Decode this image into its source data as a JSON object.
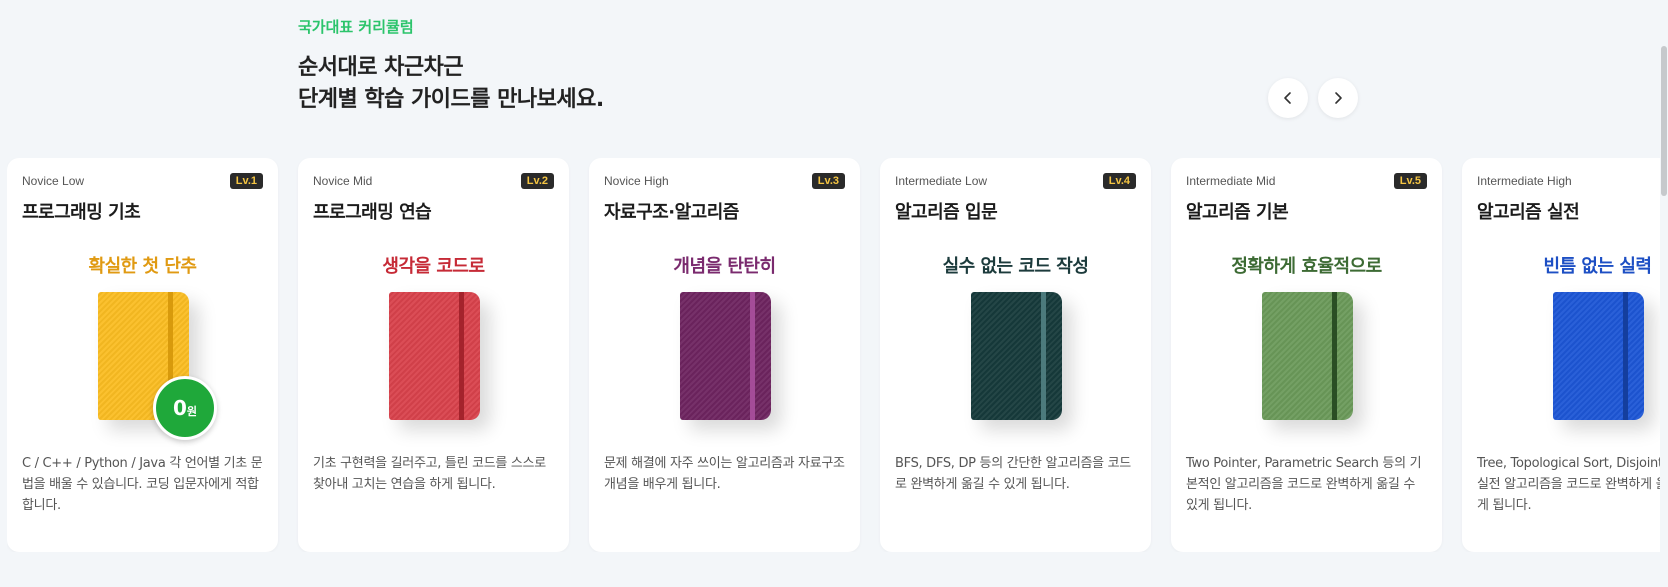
{
  "section": {
    "eyebrow": "국가대표 커리큘럼",
    "headline_line1": "순서대로 차근차근",
    "headline_line2": "단계별 학습 가이드를 만나보세요."
  },
  "nav": {
    "prev_icon": "chevron-left-icon",
    "next_icon": "chevron-right-icon"
  },
  "cards": [
    {
      "level": "Novice Low",
      "badge": "Lv.1",
      "title": "프로그래밍 기초",
      "tagline": "확실한 첫 단추",
      "accent": "#e09a12",
      "book_color": "#fbbd22",
      "strap_color": "#d89a0c",
      "desc": "C / C++ / Python / Java 각 언어별 기초 문법을 배울 수 있습니다. 코딩 입문자에게 적합합니다.",
      "price_num": "0",
      "price_unit": "원"
    },
    {
      "level": "Novice Mid",
      "badge": "Lv.2",
      "title": "프로그래밍 연습",
      "tagline": "생각을 코드로",
      "accent": "#c62a36",
      "book_color": "#d9424c",
      "strap_color": "#a4232c",
      "desc": "기초 구현력을 길러주고, 틀린 코드를 스스로 찾아내 고치는 연습을 하게 됩니다."
    },
    {
      "level": "Novice High",
      "badge": "Lv.3",
      "title": "자료구조·알고리즘",
      "tagline": "개념을 탄탄히",
      "accent": "#7a2a6e",
      "book_color": "#6e2460",
      "strap_color": "#a44c98",
      "desc": "문제 해결에 자주 쓰이는 알고리즘과 자료구조 개념을 배우게 됩니다."
    },
    {
      "level": "Intermediate Low",
      "badge": "Lv.4",
      "title": "알고리즘 입문",
      "tagline": "실수 없는 코드 작성",
      "accent": "#1c3b3c",
      "book_color": "#163a3b",
      "strap_color": "#4c7a7c",
      "desc": "BFS, DFS, DP 등의 간단한 알고리즘을 코드로 완벽하게 옮길 수 있게 됩니다."
    },
    {
      "level": "Intermediate Mid",
      "badge": "Lv.5",
      "title": "알고리즘 기본",
      "tagline": "정확하게 효율적으로",
      "accent": "#3d6b34",
      "book_color": "#6b9a5a",
      "strap_color": "#2a4e24",
      "desc": "Two Pointer, Parametric Search 등의 기본적인 알고리즘을 코드로 완벽하게 옮길 수 있게 됩니다."
    },
    {
      "level": "Intermediate High",
      "badge": "",
      "title": "알고리즘 실전",
      "tagline": "빈틈 없는 실력",
      "accent": "#1d4fc4",
      "book_color": "#1d56d6",
      "strap_color": "#143e9e",
      "desc": "Tree, Topological Sort, Disjoint Set 등의 실전 알고리즘을 코드로 완벽하게 옮길 수 있게 됩니다."
    }
  ]
}
